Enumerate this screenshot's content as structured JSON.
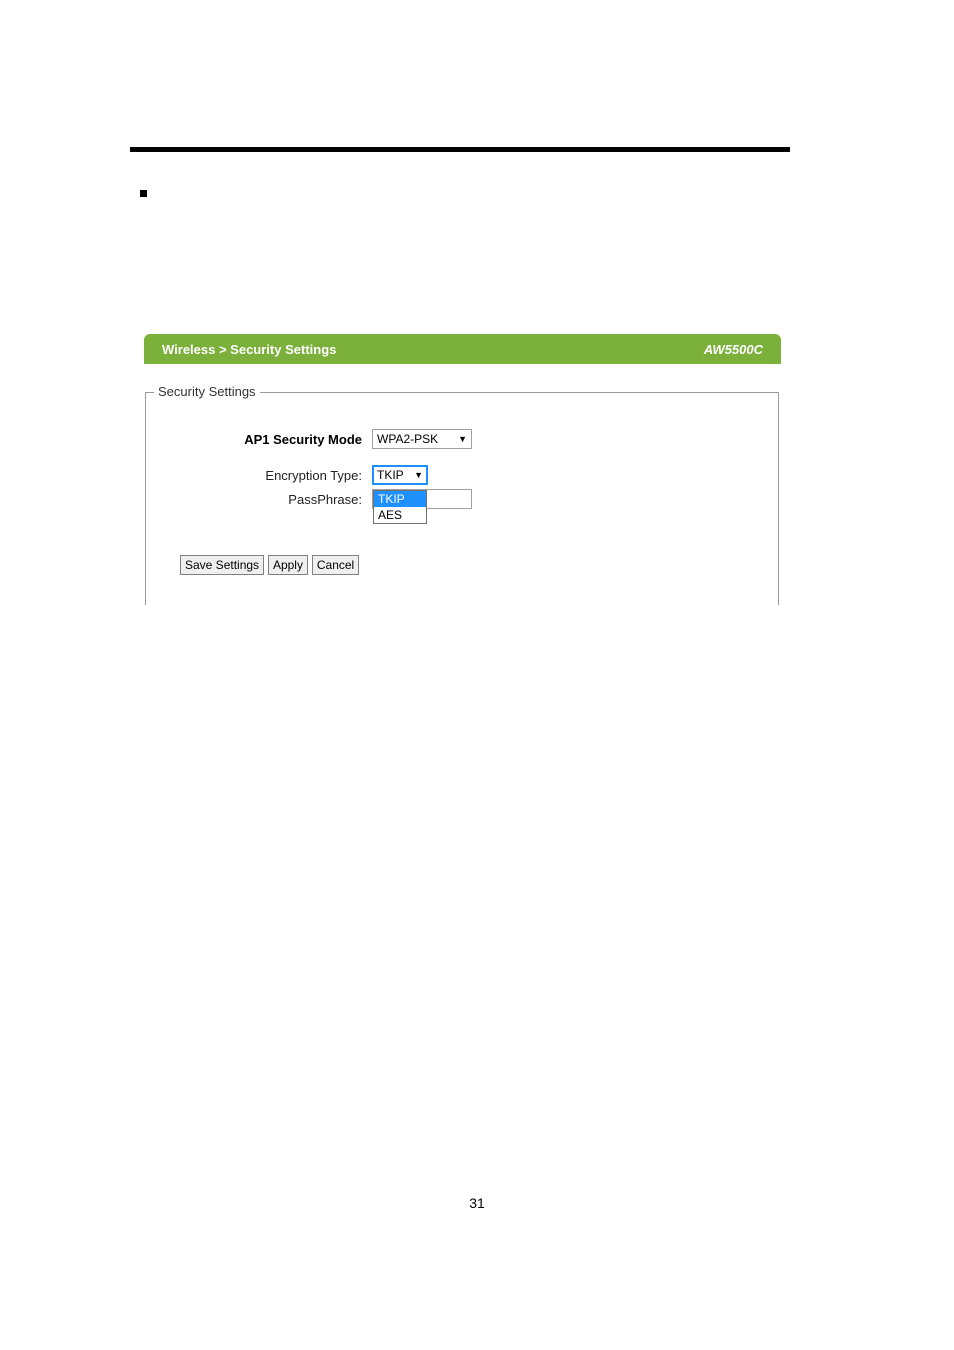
{
  "page_number": "31",
  "panel": {
    "breadcrumb": "Wireless > Security Settings",
    "model": "AW5500C"
  },
  "fieldset": {
    "legend": "Security Settings",
    "security_mode": {
      "label": "AP1 Security Mode",
      "value": "WPA2-PSK"
    },
    "encryption_type": {
      "label": "Encryption Type:",
      "value": "TKIP",
      "option_tkip": "TKIP",
      "option_aes": "AES"
    },
    "passphrase": {
      "label": "PassPhrase:",
      "value": ""
    },
    "buttons": {
      "save": "Save Settings",
      "apply": "Apply",
      "cancel": "Cancel"
    }
  }
}
